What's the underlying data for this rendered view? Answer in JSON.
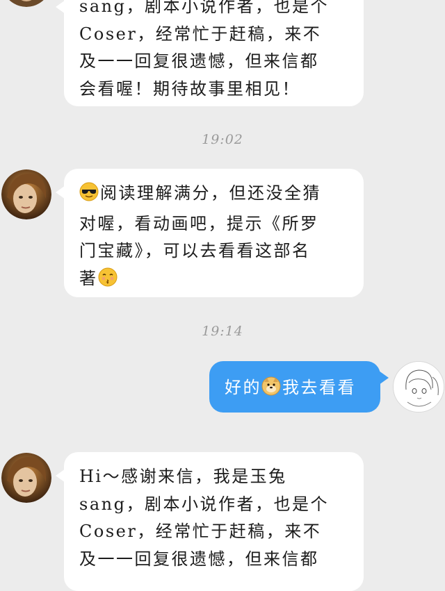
{
  "messages": [
    {
      "type": "incoming",
      "lines": [
        "sang，剧本小说作者，也是个",
        "Coser，经常忙于赶稿，来不",
        "及一一回复很遗憾，但来信都",
        "会看喔！期待故事里相见！"
      ]
    },
    {
      "type": "time",
      "text": "19:02"
    },
    {
      "type": "incoming",
      "lines": [
        "阅读理解满分，但还没全猜",
        "对喔，看动画吧，提示《所罗",
        "门宝藏》，可以去看看这部名",
        "著"
      ],
      "emojis": [
        "cool-face",
        "kiss-face"
      ]
    },
    {
      "type": "time",
      "text": "19:14"
    },
    {
      "type": "outgoing",
      "before": "好的",
      "after": "我去看看",
      "emoji": "doge"
    },
    {
      "type": "incoming",
      "lines": [
        "Hi～感谢来信，我是玉兔",
        "sang，剧本小说作者，也是个",
        "Coser，经常忙于赶稿，来不",
        "及一一回复很遗憾，但来信都"
      ]
    }
  ],
  "colors": {
    "background": "#ececec",
    "incoming_bubble": "#ffffff",
    "outgoing_bubble": "#3d9df3",
    "timestamp": "#9a9a9a"
  }
}
